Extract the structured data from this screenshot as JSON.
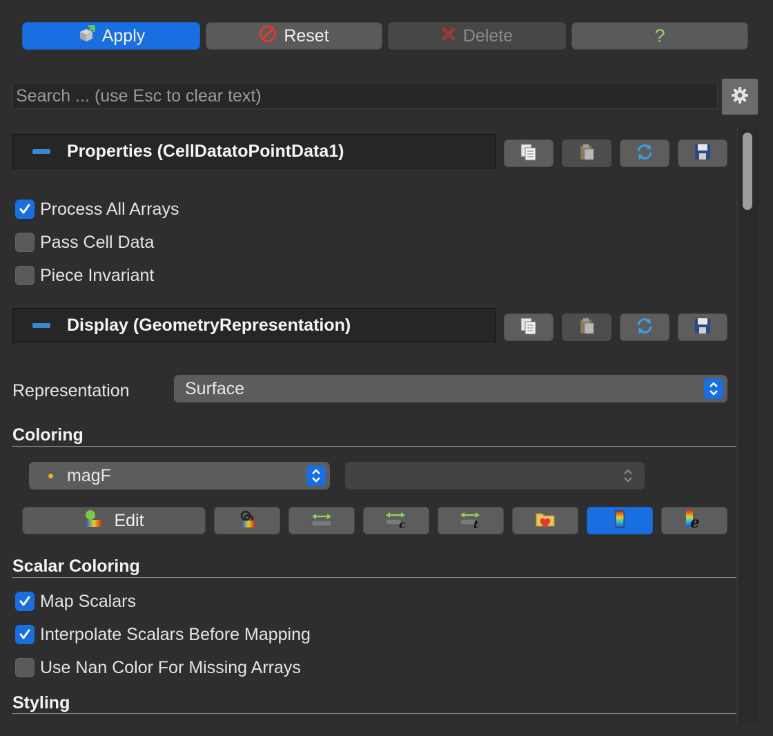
{
  "toolbar": {
    "apply": "Apply",
    "reset": "Reset",
    "delete": "Delete",
    "help": "?"
  },
  "search": {
    "placeholder": "Search ... (use Esc to clear text)"
  },
  "properties_section": {
    "title": "Properties (CellDatatoPointData1)",
    "options": [
      {
        "label": "Process All Arrays",
        "checked": true
      },
      {
        "label": "Pass Cell Data",
        "checked": false
      },
      {
        "label": "Piece Invariant",
        "checked": false
      }
    ]
  },
  "display_section": {
    "title": "Display (GeometryRepresentation)",
    "representation_label": "Representation",
    "representation_value": "Surface"
  },
  "coloring": {
    "title": "Coloring",
    "array_value": "magF",
    "component_value": "",
    "edit_label": "Edit"
  },
  "scalar_coloring": {
    "title": "Scalar Coloring",
    "options": [
      {
        "label": "Map Scalars",
        "checked": true
      },
      {
        "label": "Interpolate Scalars Before Mapping",
        "checked": true
      },
      {
        "label": "Use Nan Color For Missing Arrays",
        "checked": false
      }
    ]
  },
  "styling": {
    "title": "Styling"
  },
  "colors": {
    "accent": "#1a6fe0",
    "background": "#2e2e2e",
    "section_minus": "#3a87d6",
    "point_dot": "#f0b020"
  }
}
